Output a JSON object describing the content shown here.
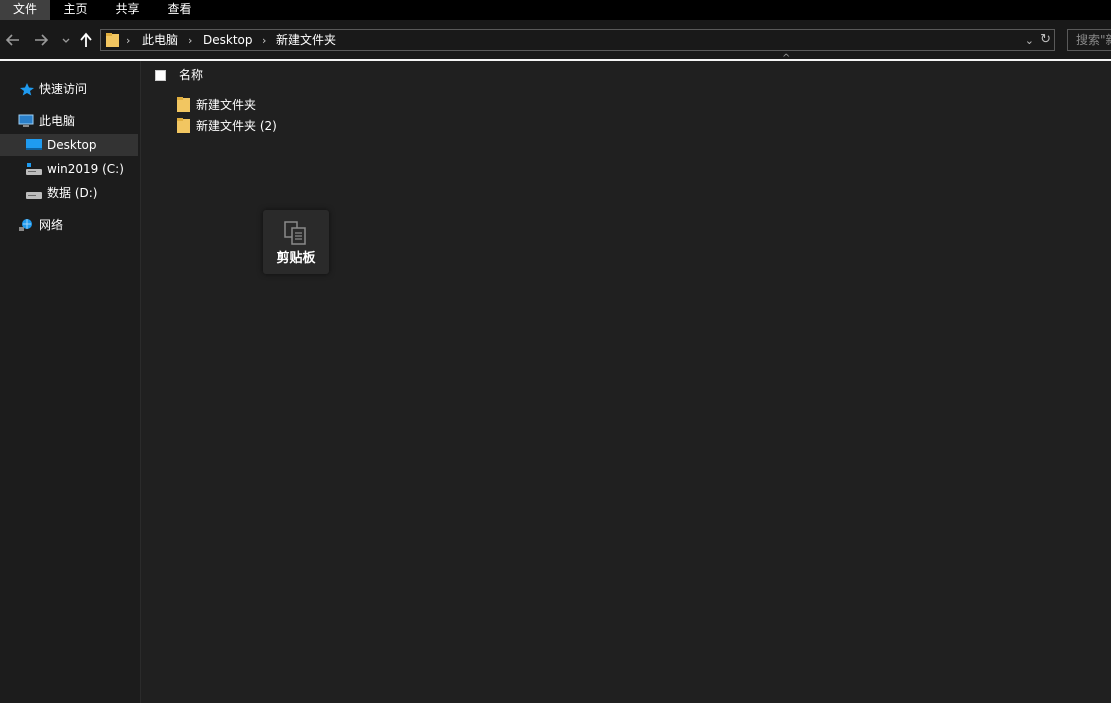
{
  "ribbon": {
    "tabs": [
      "文件",
      "主页",
      "共享",
      "查看"
    ]
  },
  "address_bar": {
    "breadcrumbs": [
      "此电脑",
      "Desktop",
      "新建文件夹"
    ],
    "search_placeholder": "搜索\"新"
  },
  "sidebar": {
    "items": [
      {
        "label": "快速访问",
        "icon": "star-icon"
      },
      {
        "label": "此电脑",
        "icon": "computer-icon"
      },
      {
        "label": "Desktop",
        "icon": "desktop-icon"
      },
      {
        "label": "win2019 (C:)",
        "icon": "system-drive-icon"
      },
      {
        "label": "数据 (D:)",
        "icon": "drive-icon"
      },
      {
        "label": "网络",
        "icon": "network-icon"
      }
    ]
  },
  "file_list": {
    "column_name": "名称",
    "items": [
      "新建文件夹",
      "新建文件夹 (2)"
    ]
  },
  "clipboard_popup": {
    "label": "剪贴板"
  },
  "colors": {
    "background": "#202020",
    "sidebar_bg": "#1c1c1c",
    "selected_bg": "#333333",
    "folder_yellow": "#f2c661",
    "accent_blue": "#1f9bf0"
  }
}
